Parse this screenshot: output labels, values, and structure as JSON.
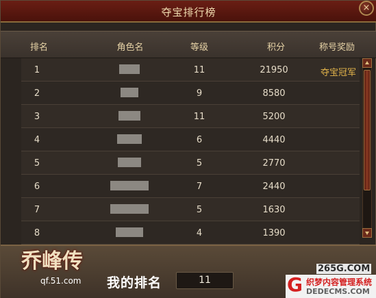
{
  "window": {
    "title": "夺宝排行榜",
    "close_icon": "×"
  },
  "columns": {
    "rank": "排名",
    "name": "角色名",
    "level": "等级",
    "score": "积分",
    "reward": "称号奖励"
  },
  "rows": [
    {
      "rank": "1",
      "level": "11",
      "score": "21950",
      "reward": "夺宝冠军"
    },
    {
      "rank": "2",
      "level": "9",
      "score": "8580",
      "reward": ""
    },
    {
      "rank": "3",
      "level": "11",
      "score": "5200",
      "reward": ""
    },
    {
      "rank": "4",
      "level": "6",
      "score": "4440",
      "reward": ""
    },
    {
      "rank": "5",
      "level": "5",
      "score": "2770",
      "reward": ""
    },
    {
      "rank": "6",
      "level": "7",
      "score": "2440",
      "reward": ""
    },
    {
      "rank": "7",
      "level": "5",
      "score": "1630",
      "reward": ""
    },
    {
      "rank": "8",
      "level": "4",
      "score": "1390",
      "reward": ""
    }
  ],
  "footer": {
    "logo_title": "乔峰传",
    "logo_url": "qf.51.com",
    "my_rank_label": "我的排名",
    "my_rank_value": "11"
  },
  "watermark": {
    "site": "265G.COM",
    "mark": "G",
    "cn": "织梦内容管理系统",
    "en": "DEDECMS.COM"
  },
  "colors": {
    "title_bar": "#5a160e",
    "reward_text": "#e2b34a",
    "row_text": "#e6dcc8",
    "header_text": "#e6d2a6"
  }
}
